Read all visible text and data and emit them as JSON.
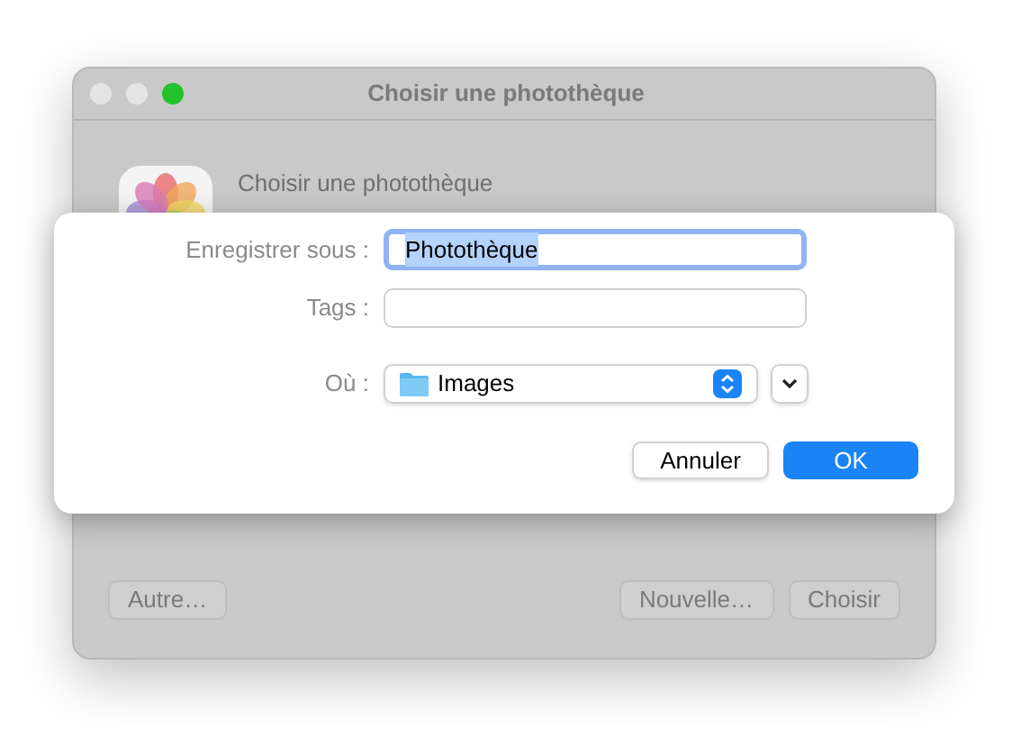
{
  "window": {
    "title": "Choisir une photothèque",
    "heading": "Choisir une photothèque",
    "buttons": [
      {
        "label": "Autre…",
        "kind": "left"
      },
      {
        "label": "Nouvelle…",
        "kind": "right"
      },
      {
        "label": "Choisir",
        "kind": "right"
      }
    ]
  },
  "sheet": {
    "name_field": {
      "label": "Enregistrer sous :",
      "value": "Photothèque",
      "focused": true
    },
    "tags_field": {
      "label": "Tags :"
    },
    "location": {
      "label": "Où :",
      "value": "Images"
    },
    "buttons": [
      {
        "label": "Annuler",
        "kind": "cancel"
      },
      {
        "label": "OK",
        "kind": "default"
      }
    ]
  }
}
